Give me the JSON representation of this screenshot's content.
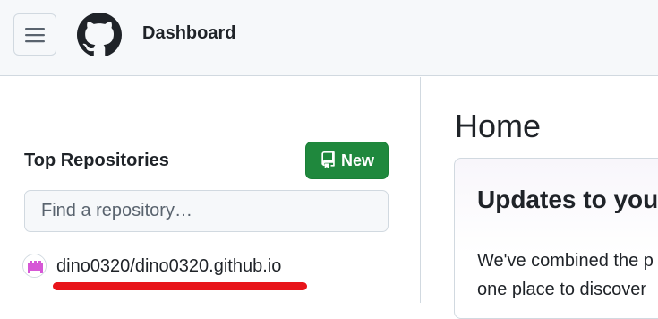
{
  "header": {
    "title": "Dashboard",
    "menu_icon": "hamburger-menu-icon",
    "logo_icon": "github-mark-icon"
  },
  "sidebar": {
    "heading": "Top Repositories",
    "new_button": {
      "label": "New",
      "icon": "repo-icon",
      "color": "#1f883d"
    },
    "search": {
      "placeholder": "Find a repository…",
      "value": ""
    },
    "repositories": [
      {
        "name": "dino0320/dino0320.github.io",
        "avatar_icon": "user-avatar-icon"
      }
    ]
  },
  "main": {
    "title": "Home",
    "updates_card": {
      "title": "Updates to you",
      "lines": [
        "We've combined the p",
        "one place to discover"
      ]
    }
  },
  "annotation": {
    "underline_color": "#e8141a"
  }
}
